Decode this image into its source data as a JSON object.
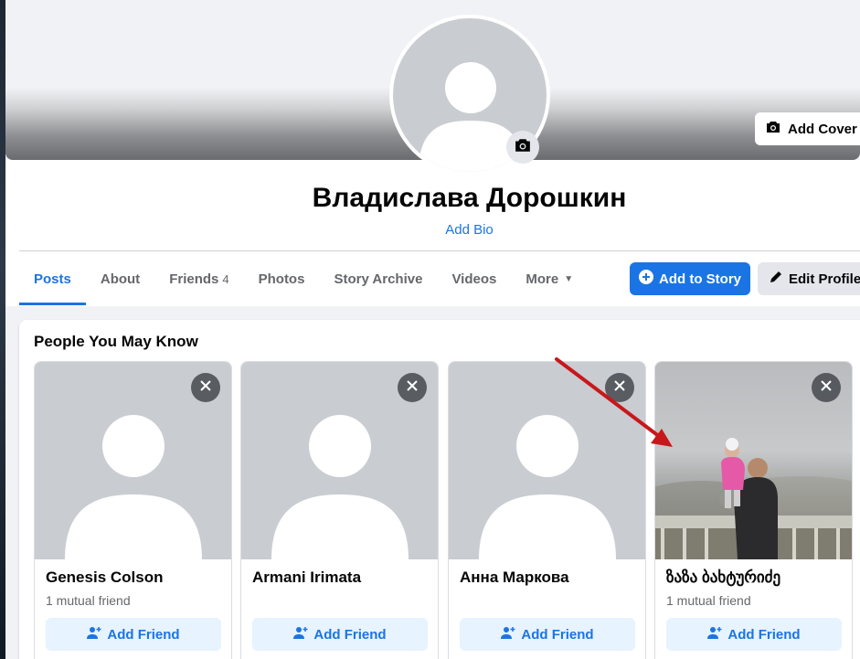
{
  "cover": {
    "add_cover_label": "Add Cover P"
  },
  "profile": {
    "name": "Владислава Дорошкин",
    "add_bio": "Add Bio"
  },
  "tabs": [
    {
      "label": "Posts",
      "active": true
    },
    {
      "label": "About"
    },
    {
      "label": "Friends",
      "count": "4"
    },
    {
      "label": "Photos"
    },
    {
      "label": "Story Archive"
    },
    {
      "label": "Videos"
    },
    {
      "label": "More"
    }
  ],
  "actions": {
    "add_story": "Add to Story",
    "edit_profile": "Edit Profile"
  },
  "pymk": {
    "title": "People You May Know",
    "add_label": "Add Friend",
    "cards": [
      {
        "name": "Genesis Colson",
        "mutual": "1 mutual friend"
      },
      {
        "name": "Armani Irimata",
        "mutual": ""
      },
      {
        "name": "Анна Маркова",
        "mutual": ""
      },
      {
        "name": "ზაზა ბახტურიძე",
        "mutual": "1 mutual friend"
      }
    ]
  },
  "colors": {
    "accent": "#1b74e4",
    "annotation_arrow": "#c8171b"
  }
}
